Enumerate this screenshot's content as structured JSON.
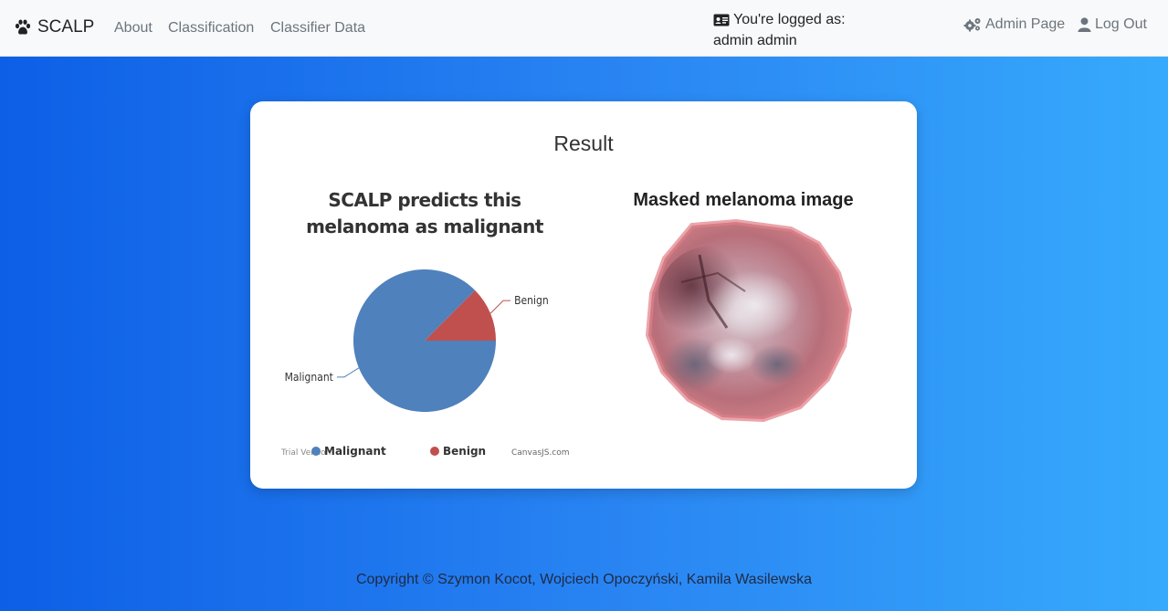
{
  "navbar": {
    "brand": "SCALP",
    "links": [
      "About",
      "Classification",
      "Classifier Data"
    ],
    "logged_line1": "You're logged as:",
    "logged_line2": "admin admin",
    "admin_page": "Admin Page",
    "log_out": "Log Out"
  },
  "card": {
    "title": "Result",
    "chart_title": "SCALP predicts this melanoma as malignant",
    "image_title": "Masked melanoma image"
  },
  "chart_data": {
    "type": "pie",
    "title": "SCALP predicts this melanoma as malignant",
    "categories": [
      "Malignant",
      "Benign"
    ],
    "values": [
      87.5,
      12.5
    ],
    "colors": [
      "#4f81bc",
      "#c0504e"
    ],
    "legend_placement": "bottom",
    "legend": [
      "Malignant",
      "Benign"
    ],
    "watermark": "Trial Version",
    "credit": "CanvasJS.com"
  },
  "footer": {
    "text": "Copyright © Szymon Kocot, Wojciech Opoczyński, Kamila Wasilewska"
  }
}
